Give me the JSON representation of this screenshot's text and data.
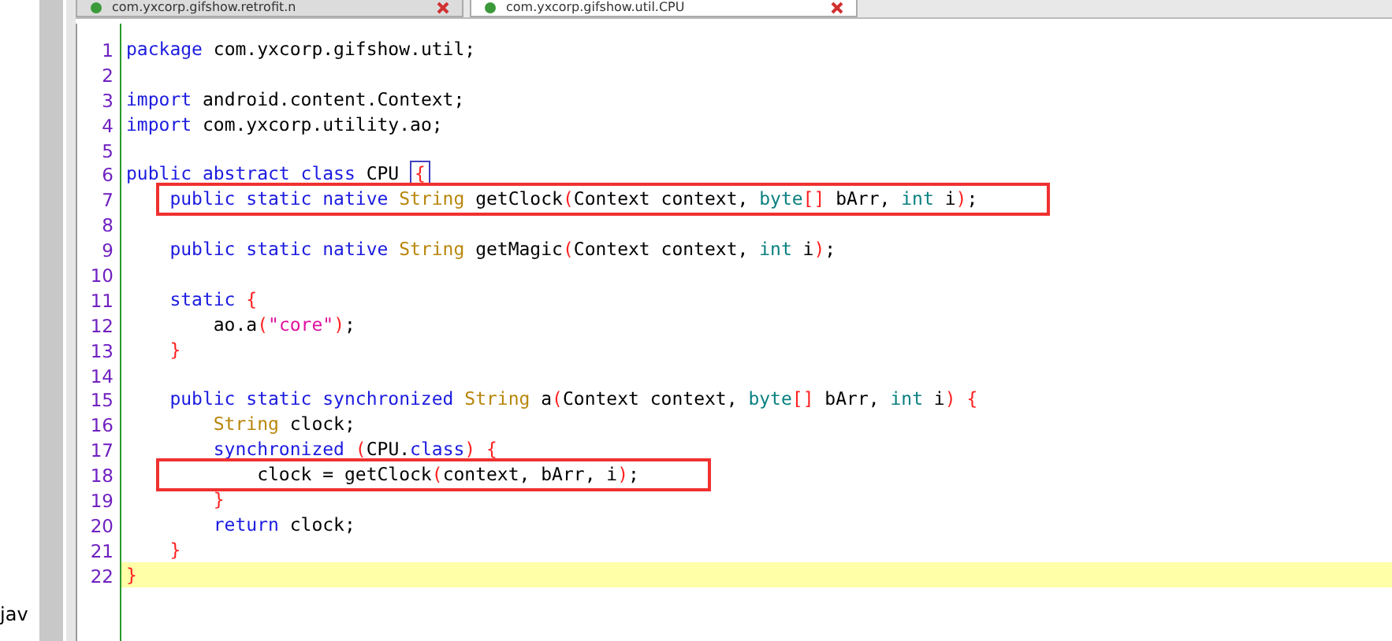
{
  "tabs": [
    {
      "label": "com.yxcorp.gifshow.retrofit.n",
      "selected": false
    },
    {
      "label": "com.yxcorp.gifshow.util.CPU",
      "selected": true
    }
  ],
  "explorer": {
    "item": "jav"
  },
  "editor": {
    "lines": [
      {
        "number": "1",
        "tokens": [
          {
            "t": "package",
            "kind": "keyword"
          },
          {
            "t": " com.yxcorp.gifshow.util;",
            "kind": "plain"
          }
        ]
      },
      {
        "number": "2"
      },
      {
        "number": "3",
        "tokens": [
          {
            "t": "import",
            "kind": "keyword"
          },
          {
            "t": " android.content.Context;",
            "kind": "plain"
          }
        ]
      },
      {
        "number": "4",
        "tokens": [
          {
            "t": "import",
            "kind": "keyword"
          },
          {
            "t": " com.yxcorp.utility.ao;",
            "kind": "plain"
          }
        ]
      },
      {
        "number": "5"
      },
      {
        "number": "6",
        "tokens": [
          {
            "t": "public abstract class",
            "kind": "keyword"
          },
          {
            "t": " CPU ",
            "kind": "plain"
          },
          {
            "t": "{",
            "kind": "bracket",
            "matched": true
          }
        ]
      },
      {
        "number": "7",
        "boxed": true,
        "tokens": [
          {
            "t": "    public static native",
            "kind": "keyword"
          },
          {
            "t": " String",
            "kind": "type"
          },
          {
            "t": " getClock",
            "kind": "plain"
          },
          {
            "t": "(",
            "kind": "bracket"
          },
          {
            "t": "Context context, ",
            "kind": "plain"
          },
          {
            "t": "byte",
            "kind": "primitive"
          },
          {
            "t": "[]",
            "kind": "bracket"
          },
          {
            "t": " bArr, ",
            "kind": "plain"
          },
          {
            "t": "int",
            "kind": "primitive"
          },
          {
            "t": " i",
            "kind": "plain"
          },
          {
            "t": ")",
            "kind": "bracket"
          },
          {
            "t": ";",
            "kind": "plain"
          }
        ]
      },
      {
        "number": "8"
      },
      {
        "number": "9",
        "tokens": [
          {
            "t": "    public static native",
            "kind": "keyword"
          },
          {
            "t": " String",
            "kind": "type"
          },
          {
            "t": " getMagic",
            "kind": "plain"
          },
          {
            "t": "(",
            "kind": "bracket"
          },
          {
            "t": "Context context, ",
            "kind": "plain"
          },
          {
            "t": "int",
            "kind": "primitive"
          },
          {
            "t": " i",
            "kind": "plain"
          },
          {
            "t": ")",
            "kind": "bracket"
          },
          {
            "t": ";",
            "kind": "plain"
          }
        ]
      },
      {
        "number": "10"
      },
      {
        "number": "11",
        "tokens": [
          {
            "t": "    static",
            "kind": "keyword"
          },
          {
            "t": " {",
            "kind": "bracket"
          }
        ]
      },
      {
        "number": "12",
        "tokens": [
          {
            "t": "        ao.a",
            "kind": "plain"
          },
          {
            "t": "(",
            "kind": "bracket"
          },
          {
            "t": "\"core\"",
            "kind": "string"
          },
          {
            "t": ")",
            "kind": "bracket"
          },
          {
            "t": ";",
            "kind": "plain"
          }
        ]
      },
      {
        "number": "13",
        "tokens": [
          {
            "t": "    }",
            "kind": "bracket"
          }
        ]
      },
      {
        "number": "14"
      },
      {
        "number": "15",
        "tokens": [
          {
            "t": "    public static synchronized",
            "kind": "keyword"
          },
          {
            "t": " String",
            "kind": "type"
          },
          {
            "t": " a",
            "kind": "plain"
          },
          {
            "t": "(",
            "kind": "bracket"
          },
          {
            "t": "Context context, ",
            "kind": "plain"
          },
          {
            "t": "byte",
            "kind": "primitive"
          },
          {
            "t": "[]",
            "kind": "bracket"
          },
          {
            "t": " bArr, ",
            "kind": "plain"
          },
          {
            "t": "int",
            "kind": "primitive"
          },
          {
            "t": " i",
            "kind": "plain"
          },
          {
            "t": ") {",
            "kind": "bracket"
          }
        ]
      },
      {
        "number": "16",
        "tokens": [
          {
            "t": "        String",
            "kind": "type"
          },
          {
            "t": " clock;",
            "kind": "plain"
          }
        ]
      },
      {
        "number": "17",
        "tokens": [
          {
            "t": "        synchronized",
            "kind": "keyword"
          },
          {
            "t": " (",
            "kind": "bracket"
          },
          {
            "t": "CPU.",
            "kind": "plain"
          },
          {
            "t": "class",
            "kind": "keyword"
          },
          {
            "t": ") {",
            "kind": "bracket"
          }
        ]
      },
      {
        "number": "18",
        "boxed": true,
        "tokens": [
          {
            "t": "            clock = getClock",
            "kind": "plain"
          },
          {
            "t": "(",
            "kind": "bracket"
          },
          {
            "t": "context, bArr, i",
            "kind": "plain"
          },
          {
            "t": ")",
            "kind": "bracket"
          },
          {
            "t": ";",
            "kind": "plain"
          }
        ]
      },
      {
        "number": "19",
        "tokens": [
          {
            "t": "        }",
            "kind": "bracket"
          }
        ]
      },
      {
        "number": "20",
        "tokens": [
          {
            "t": "        return",
            "kind": "keyword"
          },
          {
            "t": " clock;",
            "kind": "plain"
          }
        ]
      },
      {
        "number": "21",
        "tokens": [
          {
            "t": "    }",
            "kind": "bracket"
          }
        ]
      },
      {
        "number": "22",
        "current": true,
        "tokens": [
          {
            "t": "}",
            "kind": "bracket"
          }
        ]
      }
    ]
  }
}
